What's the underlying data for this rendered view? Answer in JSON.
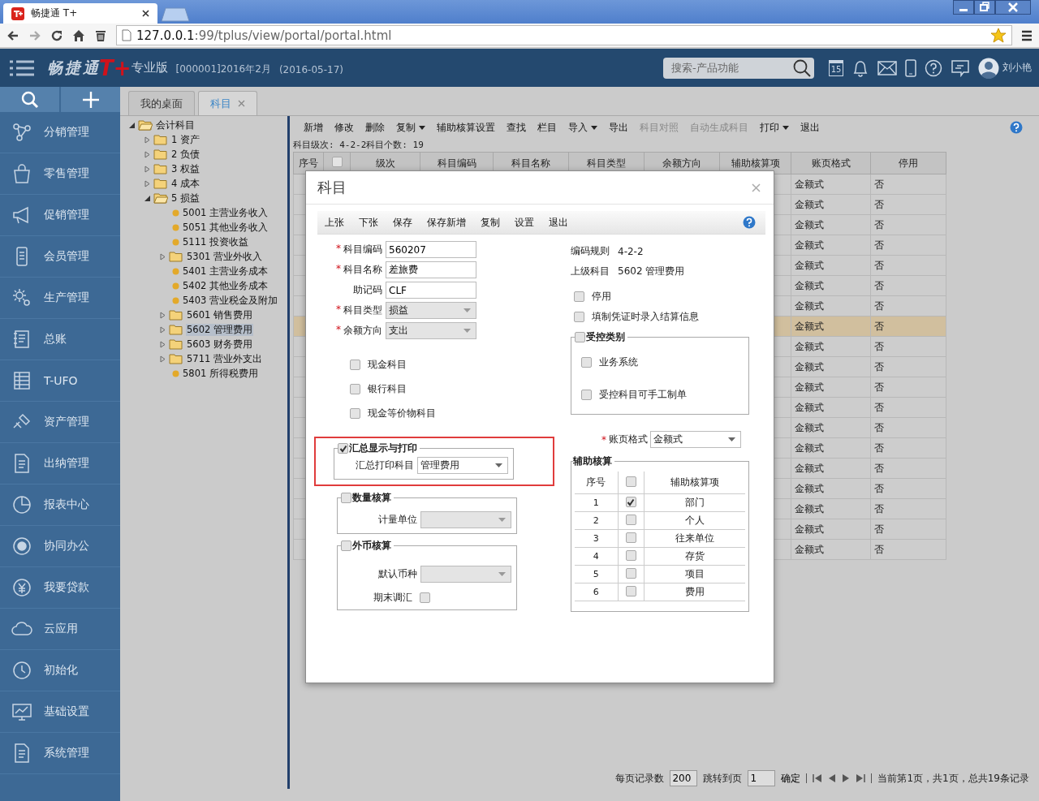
{
  "browser": {
    "tab_title": "畅捷通 T+",
    "url_host": "127.0.0.1",
    "url_rest": ":99/tplus/view/portal/portal.html"
  },
  "app_header": {
    "brand": "畅捷通",
    "brand_mark": "T+",
    "edition": "专业版",
    "account": "[000001]2016年2月",
    "date": "(2016-05-17)",
    "search_placeholder": "搜索-产品功能",
    "calendar_day": "15",
    "user": "刘小艳"
  },
  "sidebar": {
    "items": [
      {
        "label": "分销管理",
        "selected": false
      },
      {
        "label": "零售管理",
        "selected": false
      },
      {
        "label": "促销管理",
        "selected": false
      },
      {
        "label": "会员管理",
        "selected": false
      },
      {
        "label": "生产管理",
        "selected": false
      },
      {
        "label": "总账",
        "selected": false
      },
      {
        "label": "T-UFO",
        "selected": false
      },
      {
        "label": "资产管理",
        "selected": false
      },
      {
        "label": "出纳管理",
        "selected": false
      },
      {
        "label": "报表中心",
        "selected": false
      },
      {
        "label": "协同办公",
        "selected": false
      },
      {
        "label": "我要贷款",
        "selected": false
      },
      {
        "label": "云应用",
        "selected": false
      },
      {
        "label": "初始化",
        "selected": false
      },
      {
        "label": "基础设置",
        "selected": false
      },
      {
        "label": "系统管理",
        "selected": false
      }
    ]
  },
  "tabs": [
    {
      "label": "我的桌面",
      "selected": false,
      "closable": false
    },
    {
      "label": "科目",
      "selected": true,
      "closable": true
    }
  ],
  "tree": [
    {
      "label": "会计科目",
      "kind": "folder",
      "expanded": true,
      "selected": false,
      "children": [
        {
          "label": "1 资产",
          "kind": "folder",
          "expanded": false,
          "selected": false
        },
        {
          "label": "2 负债",
          "kind": "folder",
          "expanded": false,
          "selected": false
        },
        {
          "label": "3 权益",
          "kind": "folder",
          "expanded": false,
          "selected": false
        },
        {
          "label": "4 成本",
          "kind": "folder",
          "expanded": false,
          "selected": false
        },
        {
          "label": "5 损益",
          "kind": "folder",
          "expanded": true,
          "selected": false,
          "children": [
            {
              "label": "5001 主营业务收入",
              "kind": "leaf",
              "selected": false
            },
            {
              "label": "5051 其他业务收入",
              "kind": "leaf",
              "selected": false
            },
            {
              "label": "5111 投资收益",
              "kind": "leaf",
              "selected": false
            },
            {
              "label": "5301 营业外收入",
              "kind": "folder",
              "expanded": false,
              "selected": false
            },
            {
              "label": "5401 主营业务成本",
              "kind": "leaf",
              "selected": false
            },
            {
              "label": "5402 其他业务成本",
              "kind": "leaf",
              "selected": false
            },
            {
              "label": "5403 营业税金及附加",
              "kind": "leaf",
              "selected": false
            },
            {
              "label": "5601 销售费用",
              "kind": "folder",
              "expanded": false,
              "selected": false
            },
            {
              "label": "5602 管理费用",
              "kind": "folder",
              "expanded": false,
              "selected": true
            },
            {
              "label": "5603 财务费用",
              "kind": "folder",
              "expanded": false,
              "selected": false
            },
            {
              "label": "5711 营业外支出",
              "kind": "folder",
              "expanded": false,
              "selected": false
            },
            {
              "label": "5801 所得税费用",
              "kind": "leaf",
              "selected": false
            }
          ]
        }
      ]
    }
  ],
  "toolbar": [
    {
      "label": "新增",
      "disabled": false,
      "dropdown": false
    },
    {
      "label": "修改",
      "disabled": false,
      "dropdown": false
    },
    {
      "label": "删除",
      "disabled": false,
      "dropdown": false
    },
    {
      "label": "复制",
      "disabled": false,
      "dropdown": true
    },
    {
      "label": "辅助核算设置",
      "disabled": false,
      "dropdown": false
    },
    {
      "label": "查找",
      "disabled": false,
      "dropdown": false
    },
    {
      "label": "栏目",
      "disabled": false,
      "dropdown": false
    },
    {
      "label": "导入",
      "disabled": false,
      "dropdown": true
    },
    {
      "label": "导出",
      "disabled": false,
      "dropdown": false
    },
    {
      "label": "科目对照",
      "disabled": true,
      "dropdown": false
    },
    {
      "label": "自动生成科目",
      "disabled": true,
      "dropdown": false
    },
    {
      "label": "打印",
      "disabled": false,
      "dropdown": true
    },
    {
      "label": "退出",
      "disabled": false,
      "dropdown": false
    }
  ],
  "info_line": "科目级次:  4-2-2科目个数:  19",
  "table": {
    "columns": [
      {
        "kind": "text",
        "label": "序号"
      },
      {
        "kind": "checkbox",
        "checked": false
      },
      {
        "kind": "text",
        "label": "级次"
      },
      {
        "kind": "text",
        "label": "科目编码"
      },
      {
        "kind": "text",
        "label": "科目名称"
      },
      {
        "kind": "text",
        "label": "科目类型"
      },
      {
        "kind": "text",
        "label": "余额方向"
      },
      {
        "kind": "text",
        "label": "辅助核算项"
      },
      {
        "kind": "text",
        "label": "账页格式"
      },
      {
        "kind": "text",
        "label": "停用"
      }
    ],
    "rows": [
      {
        "page_format": "金额式",
        "disabled": "否",
        "selected": false
      },
      {
        "page_format": "金额式",
        "disabled": "否",
        "selected": false
      },
      {
        "page_format": "金额式",
        "disabled": "否",
        "selected": false
      },
      {
        "page_format": "金额式",
        "disabled": "否",
        "selected": false
      },
      {
        "page_format": "金额式",
        "disabled": "否",
        "selected": false
      },
      {
        "page_format": "金额式",
        "disabled": "否",
        "selected": false
      },
      {
        "page_format": "金额式",
        "disabled": "否",
        "selected": false
      },
      {
        "page_format": "金额式",
        "disabled": "否",
        "selected": true
      },
      {
        "page_format": "金额式",
        "disabled": "否",
        "selected": false
      },
      {
        "page_format": "金额式",
        "disabled": "否",
        "selected": false
      },
      {
        "page_format": "金额式",
        "disabled": "否",
        "selected": false
      },
      {
        "page_format": "金额式",
        "disabled": "否",
        "selected": false
      },
      {
        "page_format": "金额式",
        "disabled": "否",
        "selected": false
      },
      {
        "page_format": "金额式",
        "disabled": "否",
        "selected": false
      },
      {
        "page_format": "金额式",
        "disabled": "否",
        "selected": false
      },
      {
        "page_format": "金额式",
        "disabled": "否",
        "selected": false
      },
      {
        "page_format": "金额式",
        "disabled": "否",
        "selected": false
      },
      {
        "page_format": "金额式",
        "disabled": "否",
        "selected": false
      },
      {
        "page_format": "金额式",
        "disabled": "否",
        "selected": false
      }
    ]
  },
  "pager": {
    "page_size_label": "每页记录数",
    "page_size": "200",
    "goto_label": "跳转到页",
    "goto_page": "1",
    "confirm": "确定",
    "summary": "当前第1页，共1页，总共19条记录"
  },
  "dialog": {
    "title": "科目",
    "toolbar": [
      "上张",
      "下张",
      "保存",
      "保存新增",
      "复制",
      "设置",
      "退出"
    ],
    "fields": [
      {
        "label": "科目编码",
        "required_mark": "*",
        "kind": "input",
        "value": "560207",
        "disabled": false
      },
      {
        "label": "科目名称",
        "required_mark": "*",
        "kind": "input",
        "value": "差旅费",
        "disabled": false
      },
      {
        "label": "助记码",
        "kind": "input",
        "value": "CLF",
        "disabled": false
      },
      {
        "label": "科目类型",
        "required_mark": "*",
        "kind": "select",
        "value": "损益",
        "disabled": true
      },
      {
        "label": "余额方向",
        "required_mark": "*",
        "kind": "select",
        "value": "支出",
        "disabled": true
      }
    ],
    "info": [
      {
        "label": "编码规则",
        "value": "4-2-2"
      },
      {
        "label": "上级科目",
        "value": "5602 管理费用"
      }
    ],
    "right_options": [
      {
        "label": "停用",
        "checked": false
      },
      {
        "label": "填制凭证时录入结算信息",
        "checked": false
      }
    ],
    "left_options": [
      {
        "label": "现金科目",
        "checked": false
      },
      {
        "label": "银行科目",
        "checked": false
      },
      {
        "label": "现金等价物科目",
        "checked": false
      }
    ],
    "control_group": {
      "title": "受控类别",
      "checked": false,
      "options": [
        {
          "label": "业务系统",
          "checked": false
        },
        {
          "label": "受控科目可手工制单",
          "checked": false
        }
      ]
    },
    "summary_group": {
      "title": "汇总显示与打印",
      "checked": true,
      "highlighted": true,
      "field_label": "汇总打印科目",
      "value": "管理费用"
    },
    "ledger_format": {
      "label": "账页格式",
      "required_mark": "*",
      "value": "金额式"
    },
    "quantity_group": {
      "title": "数量核算",
      "checked": false,
      "field_label": "计量单位",
      "disabled": true
    },
    "currency_group": {
      "title": "外币核算",
      "checked": false,
      "field_label": "默认币种",
      "disabled": true,
      "adjust_label": "期末调汇",
      "adjust_checked": false
    },
    "aux_group": {
      "title": "辅助核算",
      "columns": [
        "序号",
        "辅助核算项"
      ],
      "header_checked": false,
      "rows": [
        {
          "index": "1",
          "label": "部门",
          "checked": true
        },
        {
          "index": "2",
          "label": "个人",
          "checked": false
        },
        {
          "index": "3",
          "label": "往来单位",
          "checked": false
        },
        {
          "index": "4",
          "label": "存货",
          "checked": false
        },
        {
          "index": "5",
          "label": "项目",
          "checked": false
        },
        {
          "index": "6",
          "label": "费用",
          "checked": false
        }
      ]
    }
  }
}
